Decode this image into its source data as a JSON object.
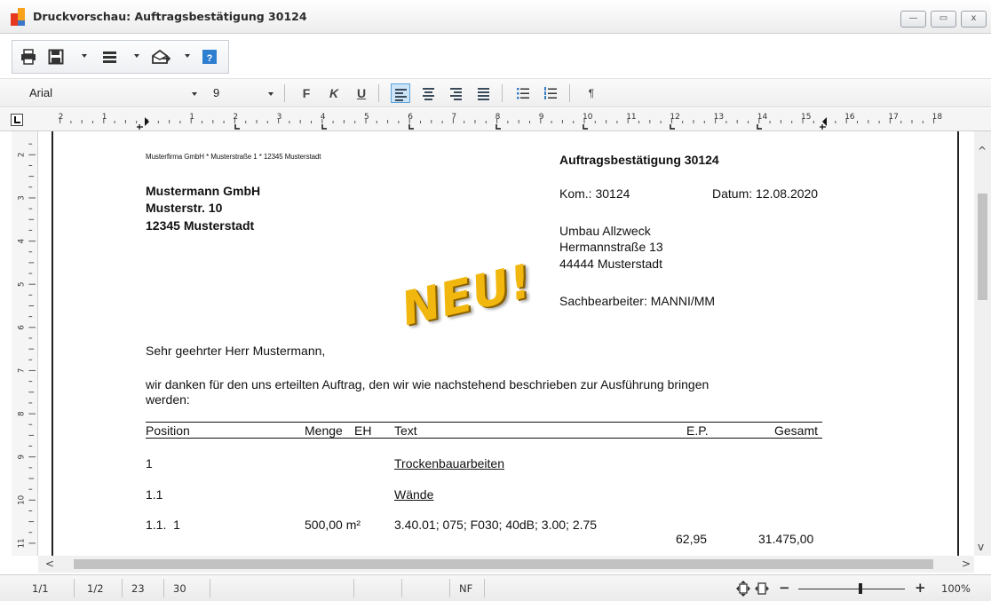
{
  "window": {
    "title": "Druckvorschau: Auftragsbestätigung 30124",
    "minimize_glyph": "—",
    "maximize_glyph": "▭",
    "close_glyph": "x"
  },
  "toolbar": {
    "icons": [
      "printer-icon",
      "save-icon",
      "menu-lines-icon",
      "email-send-icon",
      "help-icon"
    ]
  },
  "formatbar": {
    "font_name": "Arial",
    "font_size": "9",
    "bold_label": "F",
    "italic_label": "K",
    "underline_label": "U",
    "paragraph_mark": "¶",
    "active_alignment": "left"
  },
  "ruler": {
    "h_numbers": [
      "2",
      "1",
      "1",
      "2",
      "3",
      "4",
      "5",
      "6",
      "7",
      "8",
      "9",
      "10",
      "11",
      "12",
      "13",
      "14",
      "15",
      "16",
      "17",
      "18"
    ],
    "v_numbers": [
      "2",
      "3",
      "4",
      "5",
      "6",
      "7",
      "8",
      "9",
      "10",
      "11"
    ]
  },
  "document": {
    "sender_line": "Musterfirma GmbH * Musterstraße 1 * 12345 Musterstadt",
    "recipient": [
      "Mustermann GmbH",
      "Musterstr. 10",
      "12345 Musterstadt"
    ],
    "doc_title": "Auftragsbestätigung 30124",
    "kom_label": "Kom.: 30124",
    "datum_label": "Datum: 12.08.2020",
    "project": [
      "Umbau Allzweck",
      "Hermannstraße 13",
      "44444 Musterstadt"
    ],
    "clerk": "Sachbearbeiter: MANNI/MM",
    "stamp": "NEU!",
    "salutation": "Sehr geehrter Herr Mustermann,",
    "intro_line1": "wir danken für den uns erteilten Auftrag, den wir wie nachstehend beschrieben zur Ausführung bringen",
    "intro_line2": "werden:",
    "table": {
      "headers": {
        "position": "Position",
        "menge": "Menge",
        "eh": "EH",
        "text": "Text",
        "ep": "E.P.",
        "gesamt": "Gesamt"
      },
      "rows": [
        {
          "position": "1",
          "text": "Trockenbauarbeiten"
        },
        {
          "position": "1.1",
          "text": "Wände"
        },
        {
          "position": "1.1.  1",
          "menge": "500,00 m²",
          "text": "3.40.01; 075; F030; 40dB; 3.00; 2.75",
          "ep": "62,95",
          "gesamt": "31.475,00"
        }
      ]
    }
  },
  "statusbar": {
    "page": "1/1",
    "zoom_pages": "1/2",
    "line": "23",
    "col": "30",
    "mode": "NF",
    "zoom_minus": "−",
    "zoom_plus": "+",
    "zoom_value": "100%",
    "zoom_level_percent": 100
  }
}
